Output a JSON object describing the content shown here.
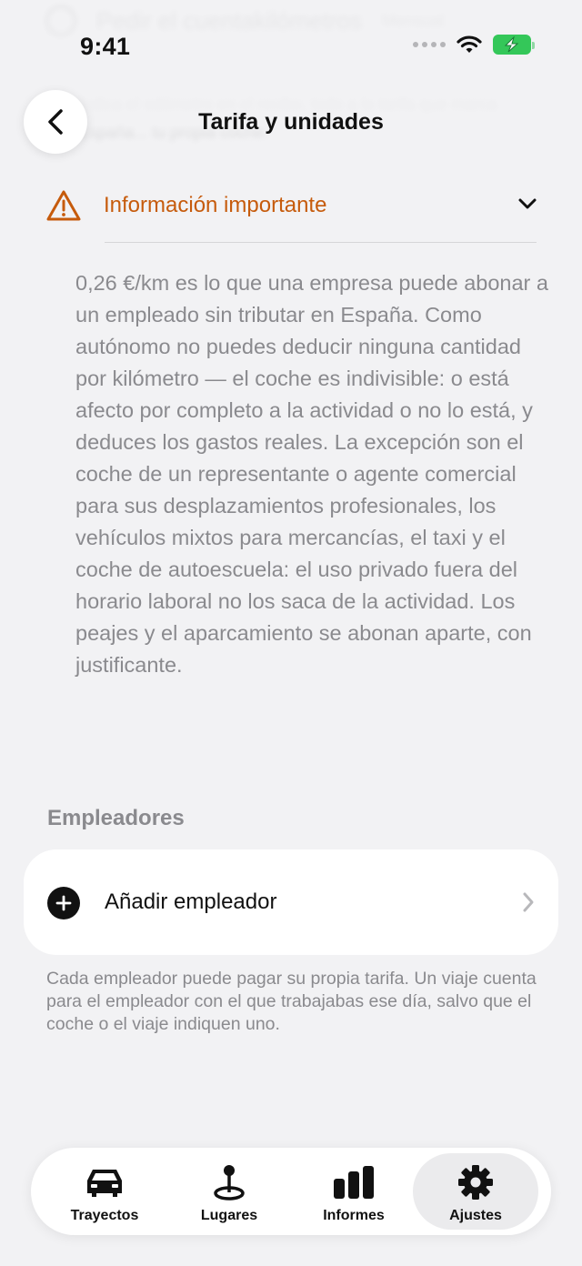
{
  "status_bar": {
    "time": "9:41"
  },
  "background_content": {
    "title": "Pedir el cuentakilómetros",
    "side": "Mensual",
    "sub": "Indica el odómetro en el recibo, todo a la tarifa que marca España... tu propia coche."
  },
  "nav": {
    "title": "Tarifa y unidades",
    "back_icon": "chevron-left-icon"
  },
  "info": {
    "label": "Información importante",
    "accent_color": "#c65b0c",
    "body": "0,26 €/km es lo que una empresa puede abonar a un empleado sin tributar en España. Como autónomo no puedes deducir ninguna cantidad por kilómetro — el coche es indivisible: o está afecto por completo a la actividad o no lo está, y deduces los gastos reales. La excepción son el coche de un representante o agente comercial para sus desplazamientos profesionales, los vehículos mixtos para mercancías, el taxi y el coche de autoescuela: el uso privado fuera del horario laboral no los saca de la actividad. Los peajes y el aparcamiento se abonan aparte, con justificante."
  },
  "employers": {
    "section_title": "Empleadores",
    "add_label": "Añadir empleador",
    "footnote": "Cada empleador puede pagar su propia tarifa. Un viaje cuenta para el empleador con el que trabajabas ese día, salvo que el coche o el viaje indiquen uno."
  },
  "tabbar": {
    "tabs": [
      {
        "label": "Trayectos",
        "icon": "car-icon",
        "active": false
      },
      {
        "label": "Lugares",
        "icon": "map-pin-icon",
        "active": false
      },
      {
        "label": "Informes",
        "icon": "bar-chart-icon",
        "active": false
      },
      {
        "label": "Ajustes",
        "icon": "gear-icon",
        "active": true
      }
    ]
  }
}
